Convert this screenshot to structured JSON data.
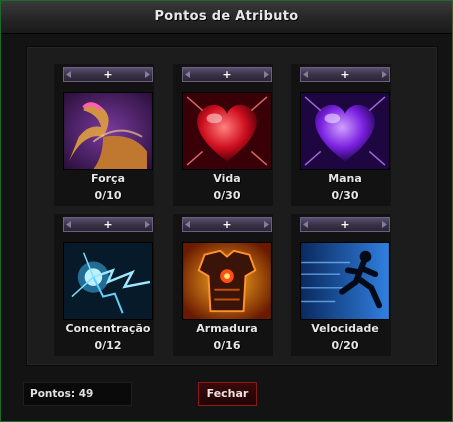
{
  "window": {
    "title": "Pontos de Atributo"
  },
  "attributes": [
    {
      "name": "Força",
      "value": "0/10",
      "add_label": "+",
      "icon": "flexed-arm-icon"
    },
    {
      "name": "Vida",
      "value": "0/30",
      "add_label": "+",
      "icon": "red-heart-icon"
    },
    {
      "name": "Mana",
      "value": "0/30",
      "add_label": "+",
      "icon": "purple-heart-icon"
    },
    {
      "name": "Concentração",
      "value": "0/12",
      "add_label": "+",
      "icon": "lightning-hand-icon"
    },
    {
      "name": "Armadura",
      "value": "0/16",
      "add_label": "+",
      "icon": "fiery-armor-icon"
    },
    {
      "name": "Velocidade",
      "value": "0/20",
      "add_label": "+",
      "icon": "running-figure-icon"
    }
  ],
  "footer": {
    "points_label": "Pontos: 49",
    "close_label": "Fechar"
  },
  "colors": {
    "window_border": "#1d6b2a",
    "close_border": "#8a1a1a",
    "plus_bar": "#3a3348"
  }
}
